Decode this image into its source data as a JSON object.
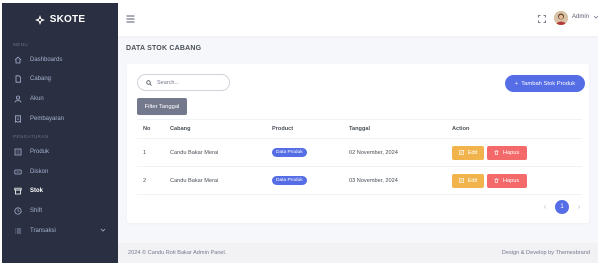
{
  "brand": {
    "name": "SKOTE"
  },
  "sidebar": {
    "menu_title": "MENU",
    "section_title": "PENGATURAN",
    "items": [
      {
        "label": "Dashboards",
        "icon": "home-icon"
      },
      {
        "label": "Cabang",
        "icon": "file-icon"
      },
      {
        "label": "Akun",
        "icon": "user-icon"
      },
      {
        "label": "Pembayaran",
        "icon": "receipt-icon"
      }
    ],
    "items2": [
      {
        "label": "Produk",
        "icon": "list-icon"
      },
      {
        "label": "Diskon",
        "icon": "tag-icon"
      },
      {
        "label": "Stok",
        "icon": "box-icon",
        "active": true
      },
      {
        "label": "Shift",
        "icon": "clock-icon"
      },
      {
        "label": "Transaksi",
        "icon": "list-icon"
      }
    ]
  },
  "topbar": {
    "user_name": "Admin"
  },
  "page": {
    "title": "DATA STOK CABANG"
  },
  "search": {
    "placeholder": "Search..."
  },
  "actions": {
    "add_label": "Tambah Stok Produk",
    "filter_label": "Filter Tanggal"
  },
  "table": {
    "headers": [
      "No",
      "Cabang",
      "Product",
      "Tanggal",
      "Action"
    ],
    "rows": [
      {
        "no": "1",
        "cabang": "Candu Bakar Merai",
        "product": "Data Produk",
        "tanggal": "02 November, 2024"
      },
      {
        "no": "2",
        "cabang": "Candu Bakar Merai",
        "product": "Data Produk",
        "tanggal": "03 November, 2024"
      }
    ],
    "edit_label": "Edit",
    "delete_label": "Hapus"
  },
  "pagination": {
    "current": "1",
    "prev": "‹",
    "next": "›"
  },
  "footer": {
    "left": "2024 © Candu Roti Bakar Admin Panel.",
    "right": "Design & Develop by Themesbrand"
  },
  "colors": {
    "sidebar": "#2a3042",
    "primary": "#556ee6",
    "warning": "#f1b44c",
    "danger": "#f46a6a",
    "secondary": "#74788d"
  }
}
